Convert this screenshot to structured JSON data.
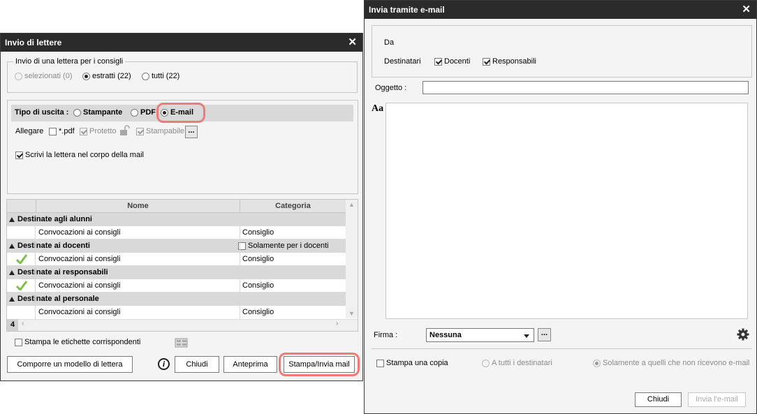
{
  "win1": {
    "title": "Invio di lettere",
    "group_title": "Invio di una lettera per i consigli",
    "radios": {
      "selezionati": "selezionati (0)",
      "estratti": "estratti (22)",
      "tutti": "tutti (22)"
    },
    "tipo_label": "Tipo di uscita :",
    "tipo_options": {
      "stampante": "Stampante",
      "pdf": "PDF",
      "email": "E-mail"
    },
    "allegare_label": "Allegare",
    "pdf_label": "*.pdf",
    "protetto_label": "Protetto",
    "stampabile_label": "Stampabile",
    "more_label": "...",
    "scrivi_label": "Scrivi la lettera nel corpo della mail",
    "table": {
      "col_nome": "Nome",
      "col_categoria": "Categoria",
      "groups": [
        {
          "title": "Destinate agli alunni",
          "extra": "",
          "row": {
            "nome": "Convocazioni ai consigli",
            "categoria": "Consiglio",
            "checked": false
          }
        },
        {
          "title": "Destinate ai docenti",
          "extra": "Solamente per i docenti liberi",
          "row": {
            "nome": "Convocazioni ai consigli",
            "categoria": "Consiglio",
            "checked": true
          }
        },
        {
          "title": "Destinate ai responsabili",
          "extra": "",
          "row": {
            "nome": "Convocazioni ai consigli",
            "categoria": "Consiglio",
            "checked": true
          }
        },
        {
          "title": "Destinate al personale",
          "extra": "",
          "row": {
            "nome": "Convocazioni ai consigli",
            "categoria": "Consiglio",
            "checked": false
          }
        }
      ],
      "count": "4"
    },
    "stampa_etichette": "Stampa le etichette corrispondenti",
    "buttons": {
      "comporre": "Comporre un modello di lettera",
      "chiudi": "Chiudi",
      "anteprima": "Anteprima",
      "stampa": "Stampa/Invia mail"
    }
  },
  "win2": {
    "title": "Invia tramite e-mail",
    "da_label": "Da",
    "destinatari_label": "Destinatari",
    "docenti_label": "Docenti",
    "responsabili_label": "Responsabili",
    "oggetto_label": "Oggetto :",
    "oggetto_value": "",
    "aa_label": "Aa",
    "firma_label": "Firma :",
    "firma_value": "Nessuna",
    "more_label": "...",
    "stampa_copia": "Stampa una copia",
    "a_tutti": "A tutti i destinatari",
    "solamente": "Solamente a quelli che non ricevono e-mail",
    "buttons": {
      "chiudi": "Chiudi",
      "invia": "Invia l'e-mail"
    }
  },
  "colors": {
    "titlebar": "#2b2b2b",
    "highlight": "#ef7b78",
    "group_row": "#d9d9d9",
    "check_green": "#7ac143"
  }
}
